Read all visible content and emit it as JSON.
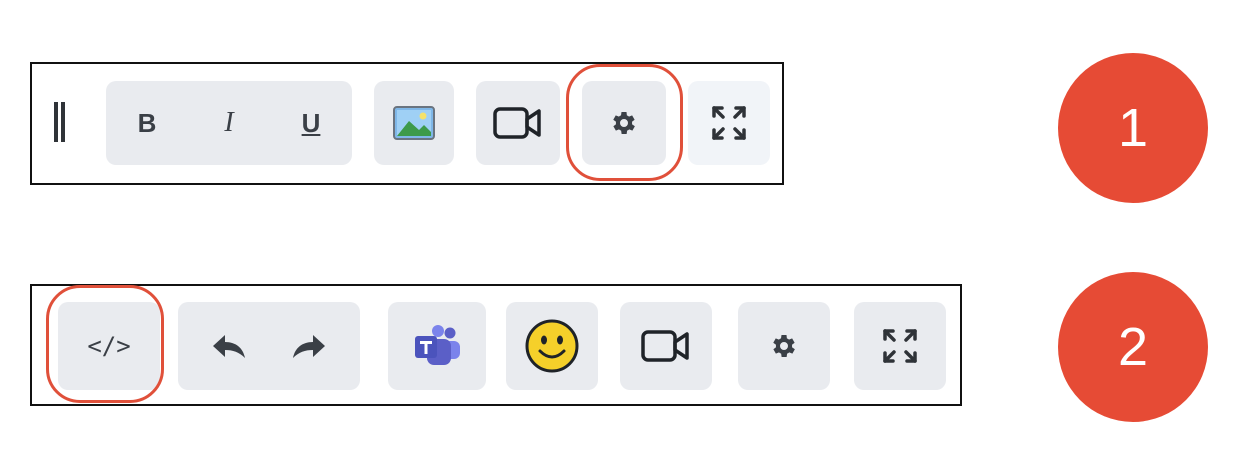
{
  "toolbar1": {
    "bold_label": "B",
    "italic_label": "I",
    "underline_label": "U",
    "icons": [
      "drag-handle-icon",
      "image-icon",
      "video-camera-icon",
      "gear-icon",
      "fullscreen-expand-icon"
    ],
    "highlighted": "gear-icon"
  },
  "toolbar2": {
    "code_label": "</>",
    "icons": [
      "code-icon",
      "undo-icon",
      "redo-icon",
      "teams-icon",
      "smiley-emoji-icon",
      "video-camera-icon",
      "gear-icon",
      "fullscreen-expand-icon"
    ],
    "highlighted": "code-icon"
  },
  "badges": {
    "first": "1",
    "second": "2"
  },
  "colors": {
    "highlight_ring": "#e0503a",
    "badge_fill": "#e64b35",
    "button_bg": "#e9ebef",
    "icon": "#3a3f46",
    "teams_purple": "#5b5fc7",
    "emoji_yellow": "#f5d02a"
  }
}
